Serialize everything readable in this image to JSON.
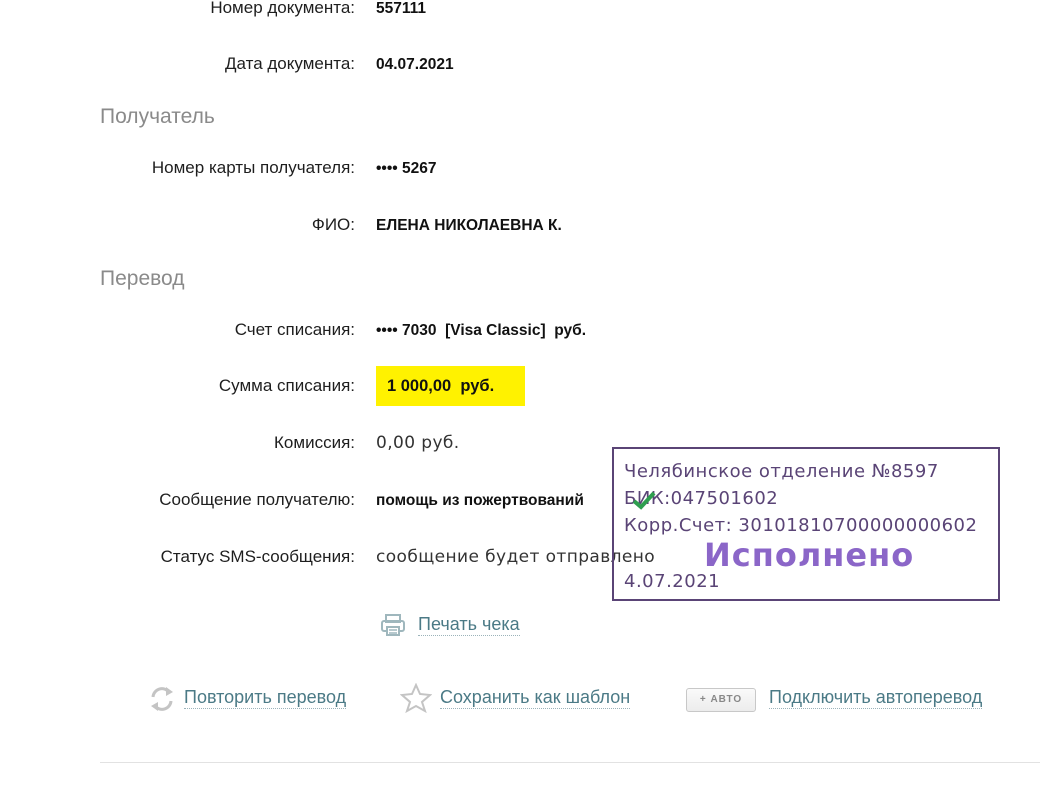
{
  "document": {
    "number_label": "Номер документа:",
    "number_value": "557111",
    "date_label": "Дата документа:",
    "date_value": "04.07.2021"
  },
  "recipient": {
    "section_title": "Получатель",
    "card_label": "Номер карты получателя:",
    "card_value": "•••• 5267",
    "name_label": "ФИО:",
    "name_value": "ЕЛЕНА НИКОЛАЕВНА К."
  },
  "transfer": {
    "section_title": "Перевод",
    "account_label": "Счет списания:",
    "account_value": "•••• 7030  [Visa Classic]  руб.",
    "amount_label": "Сумма списания:",
    "amount_value": "1 000,00  руб.",
    "fee_label": "Комиссия:",
    "fee_value": "0,00 руб.",
    "message_label": "Сообщение получателю:",
    "message_value": "помощь из пожертвований",
    "sms_label": "Статус SMS-сообщения:",
    "sms_value": "сообщение будет отправлено"
  },
  "actions": {
    "print_label": "Печать чека",
    "repeat_label": "Повторить перевод",
    "save_template_label": "Сохранить как шаблон",
    "auto_badge": "АВТО",
    "auto_transfer_label": "Подключить автоперевод"
  },
  "stamp": {
    "branch": "Челябинское отделение №8597",
    "bik": "БИК:047501602",
    "corr_account": "Корр.Счет: 30101810700000000602",
    "status": "Исполнено",
    "date": "4.07.2021",
    "color": "#5a4476"
  }
}
